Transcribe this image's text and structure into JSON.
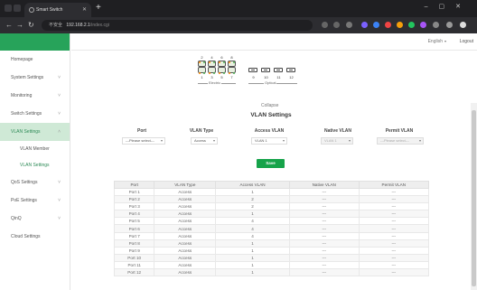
{
  "browser": {
    "tab_title": "Smart Switch",
    "url_security": "不安全",
    "url_host": "192.168.2.1",
    "url_path": "/index.cgi"
  },
  "header": {
    "language": "English",
    "logout": "Logout"
  },
  "sidebar": {
    "items": [
      {
        "label": "Homepage",
        "has_chevron": false
      },
      {
        "label": "System Settings",
        "has_chevron": true
      },
      {
        "label": "Monitoring",
        "has_chevron": true
      },
      {
        "label": "Switch Settings",
        "has_chevron": true
      },
      {
        "label": "VLAN Settings",
        "has_chevron": true,
        "active": true
      },
      {
        "label": "VLAN Member",
        "sub": true
      },
      {
        "label": "VLAN Settings",
        "sub": true,
        "active_sub": true
      },
      {
        "label": "QoS Settings",
        "has_chevron": true
      },
      {
        "label": "PoE Settings",
        "has_chevron": true
      },
      {
        "label": "QinQ",
        "has_chevron": true
      },
      {
        "label": "Cloud Settings",
        "has_chevron": false
      }
    ]
  },
  "ports": {
    "copper_top_numbers": [
      "2",
      "4",
      "6",
      "8"
    ],
    "copper_bottom_numbers": [
      "1",
      "3",
      "5",
      "7"
    ],
    "optical_numbers": [
      "9",
      "10",
      "11",
      "12"
    ],
    "copper_group_label": "Electric",
    "optical_group_label": "Optical"
  },
  "collapse_label": "Collapse",
  "vlan_settings": {
    "title": "VLAN Settings",
    "headers": [
      "Port",
      "VLAN Type",
      "Access VLAN",
      "Native VLAN",
      "Permit VLAN"
    ],
    "port_placeholder": "---Please select---",
    "vlan_type_value": "Access",
    "access_vlan_value": "VLAN 1",
    "native_vlan_value": "VLAN 1",
    "permit_vlan_placeholder": "---Please select---",
    "save_label": "Save"
  },
  "table": {
    "headers": [
      "Port",
      "VLAN Type",
      "Access VLAN",
      "Native VLAN",
      "Permit VLAN"
    ],
    "rows": [
      [
        "Port 1",
        "Access",
        "1",
        "---",
        "---"
      ],
      [
        "Port 2",
        "Access",
        "2",
        "---",
        "---"
      ],
      [
        "Port 3",
        "Access",
        "2",
        "---",
        "---"
      ],
      [
        "Port 4",
        "Access",
        "1",
        "---",
        "---"
      ],
      [
        "Port 5",
        "Access",
        "4",
        "---",
        "---"
      ],
      [
        "Port 6",
        "Access",
        "4",
        "---",
        "---"
      ],
      [
        "Port 7",
        "Access",
        "4",
        "---",
        "---"
      ],
      [
        "Port 8",
        "Access",
        "1",
        "---",
        "---"
      ],
      [
        "Port 9",
        "Access",
        "1",
        "---",
        "---"
      ],
      [
        "Port 10",
        "Access",
        "1",
        "---",
        "---"
      ],
      [
        "Port 11",
        "Access",
        "1",
        "---",
        "---"
      ],
      [
        "Port 12",
        "Access",
        "1",
        "---",
        "---"
      ]
    ]
  },
  "colors": {
    "brand": "#27a35a",
    "active_menu_bg": "#cfe9d6",
    "save_button": "#16a34a"
  }
}
